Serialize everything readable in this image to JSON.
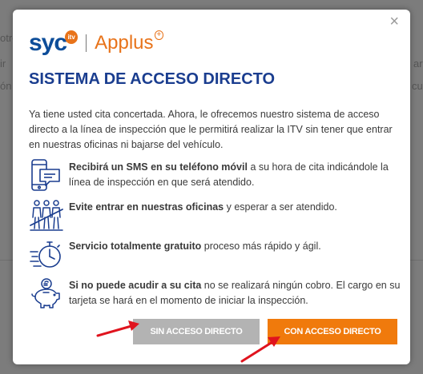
{
  "background": {
    "snippets": [
      "otro",
      "ir",
      "ón",
      "ar",
      "culo"
    ]
  },
  "modal": {
    "close_label": "×",
    "logo": {
      "syc": "syc",
      "itv": "itv",
      "applus": "Applus",
      "plus": "+"
    },
    "title": "SISTEMA DE ACCESO DIRECTO",
    "intro": "Ya tiene usted cita concertada. Ahora, le ofrecemos nuestro sistema de acceso directo a la línea de inspección que le permitirá realizar la ITV sin tener que entrar en nuestras oficinas ni bajarse del vehículo.",
    "features": [
      {
        "icon": "phone-sms-icon",
        "bold": "Recibirá un SMS en su teléfono móvil",
        "rest": " a su hora de cita indicándole la línea de inspección en que será atendido."
      },
      {
        "icon": "people-queue-icon",
        "bold": "Evite entrar en nuestras oficinas",
        "rest": " y esperar a ser atendido."
      },
      {
        "icon": "fast-stopwatch-icon",
        "bold": "Servicio totalmente gratuito",
        "rest": " proceso más rápido y ágil."
      },
      {
        "icon": "piggy-bank-icon",
        "bold": "Si no puede acudir a su cita",
        "rest": " no se realizará ningún cobro. El cargo en su tarjeta se hará en el momento de iniciar la inspección."
      }
    ],
    "buttons": {
      "no_access": "SIN ACCESO DIRECTO",
      "with_access": "CON ACCESO DIRECTO"
    }
  },
  "colors": {
    "title": "#1a3d8f",
    "accent": "#f07a0c",
    "disabled": "#b3b3b3",
    "arrow": "#e0141e"
  }
}
